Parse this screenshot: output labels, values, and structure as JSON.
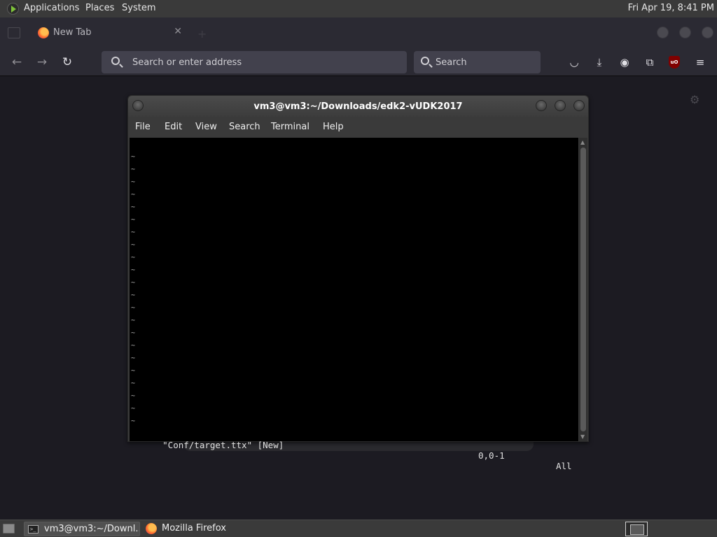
{
  "top_panel": {
    "menus": [
      "Applications",
      "Places",
      "System"
    ],
    "clock": "Fri Apr 19,  8:41 PM"
  },
  "browser": {
    "tab": {
      "label": "New Tab",
      "close": "✕"
    },
    "nav": {
      "back": "←",
      "forward": "→",
      "reload": "↻"
    },
    "urlbar_placeholder": "Search or enter address",
    "searchbar_placeholder": "Search",
    "toolbar_icons": [
      "pocket-icon",
      "download-icon",
      "account-icon",
      "extensions-icon",
      "ublock-origin-icon",
      "menu-icon"
    ],
    "ublock_badge": "uO"
  },
  "terminal": {
    "title": "vm3@vm3:~/Downloads/edk2-vUDK2017",
    "menu": [
      "File",
      "Edit",
      "View",
      "Search",
      "Terminal",
      "Help"
    ],
    "tilde_lines": [
      "~",
      "~",
      "~",
      "~",
      "~",
      "~",
      "~",
      "~",
      "~",
      "~",
      "~",
      "~",
      "~",
      "~",
      "~",
      "~",
      "~",
      "~",
      "~",
      "~",
      "~",
      "~"
    ],
    "status_file": "\"Conf/target.ttx\" [New]",
    "status_pos": "0,0-1",
    "status_all": "All"
  },
  "taskbar": {
    "terminal_label": "vm3@vm3:~/Downl...",
    "firefox_label": "Mozilla Firefox"
  },
  "colors": {
    "panel_bg": "#3a3a3a",
    "browser_bg": "#2b2a33",
    "content_bg": "#1c1b22",
    "terminal_screen": "#000000"
  }
}
